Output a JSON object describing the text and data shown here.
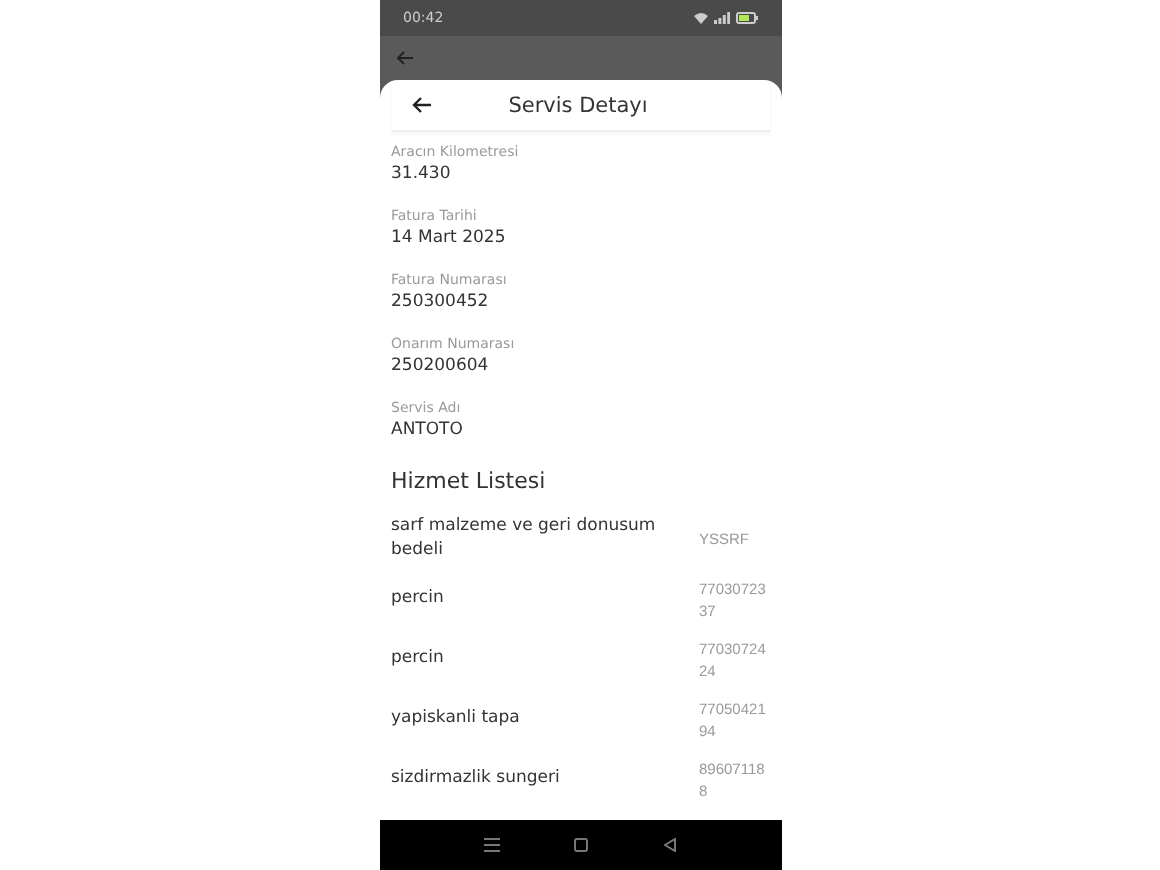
{
  "status_bar": {
    "time": "00:42"
  },
  "sheet": {
    "title": "Servis Detayı"
  },
  "fields": [
    {
      "label": "Aracın Kilometresi",
      "value": "31.430"
    },
    {
      "label": "Fatura Tarihi",
      "value": "14 Mart 2025"
    },
    {
      "label": "Fatura Numarası",
      "value": "250300452"
    },
    {
      "label": "Onarım Numarası",
      "value": "250200604"
    },
    {
      "label": "Servis Adı",
      "value": "ANTOTO"
    }
  ],
  "service_list": {
    "title": "Hizmet Listesi",
    "items": [
      {
        "name": "sarf malzeme ve geri donusum bedeli",
        "code": "YSSRF"
      },
      {
        "name": "percin",
        "code": "7703072337"
      },
      {
        "name": "percin",
        "code": "7703072424"
      },
      {
        "name": "yapiskanli tapa",
        "code": "7705042194"
      },
      {
        "name": "sizdirmazlik sungeri",
        "code": "896071188"
      }
    ]
  }
}
